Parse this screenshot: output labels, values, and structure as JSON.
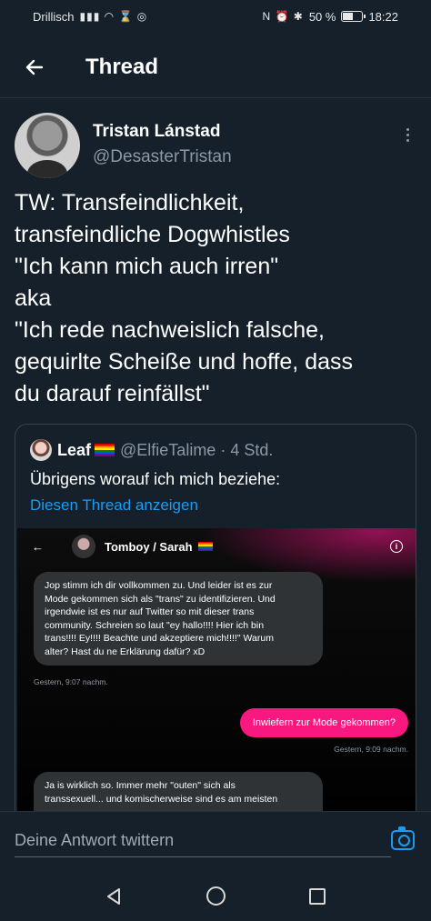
{
  "status_bar": {
    "carrier": "Drillisch",
    "indicators": "N ⏰ ✱",
    "battery_percent": "50 %",
    "battery_level": 0.5,
    "time": "18:22"
  },
  "header": {
    "back_icon": "arrow-left-icon",
    "title": "Thread"
  },
  "tweet": {
    "display_name": "Tristan Lánstad",
    "handle": "@DesasterTristan",
    "lines": [
      "TW: Transfeindlichkeit,",
      "transfeindliche Dogwhistles",
      "\"Ich kann mich auch irren\"",
      "aka",
      "\"Ich rede nachweislich falsche,",
      "gequirlte Scheiße und hoffe, dass",
      "du darauf reinfällst\""
    ]
  },
  "quote": {
    "name": "Leaf",
    "handle_time": "@ElfieTalime · 4 Std.",
    "text": "Übrigens worauf ich mich beziehe:",
    "link": "Diesen Thread anzeigen"
  },
  "screenshot": {
    "chat_title": "Tomboy / Sarah",
    "info_icon": "i",
    "msg1_lines": [
      "Jop stimm ich dir vollkommen zu. Und leider ist es zur",
      "Mode gekommen sich als \"trans\" zu identifizieren. Und",
      "irgendwie ist es nur auf Twitter so mit dieser trans",
      "community. Schreien so laut \"ey hallo!!!! Hier ich bin",
      "trans!!!! Ey!!!! Beachte und akzeptiere mich!!!!\" Warum",
      "alter? Hast du ne Erklärung dafür? xD"
    ],
    "msg1_time": "Gestern, 9:07 nachm.",
    "msg2": "Inwiefern zur Mode gekommen?",
    "msg2_time": "Gestern, 9:09 nachm.",
    "msg3_lines": [
      "Ja is wirklich so. Immer mehr \"outen\" sich als",
      "transsexuell... und komischerweise sind es am meisten"
    ]
  },
  "reply": {
    "placeholder": "Deine Antwort twittern",
    "camera_icon": "camera-icon"
  },
  "colors": {
    "background": "#15202b",
    "accent": "#1d9bf0",
    "pink": "#f91880"
  }
}
